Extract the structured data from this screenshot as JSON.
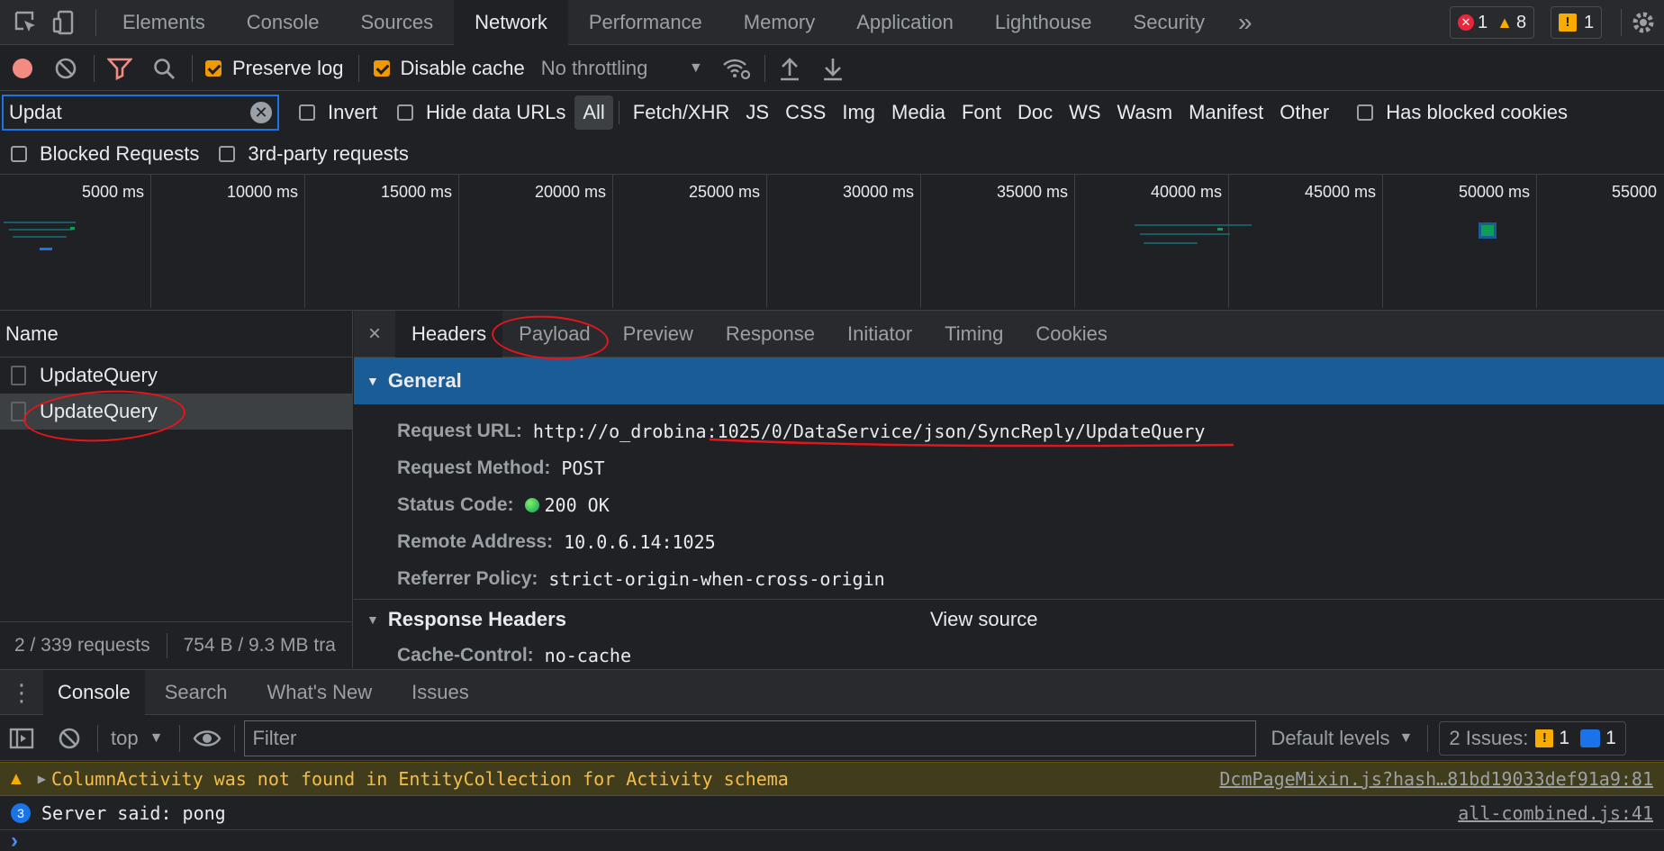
{
  "toolbar_top": {
    "tabs": [
      "Elements",
      "Console",
      "Sources",
      "Network",
      "Performance",
      "Memory",
      "Application",
      "Lighthouse",
      "Security"
    ],
    "more": "»",
    "errors_count": "1",
    "warnings_count": "8",
    "issues_count": "1"
  },
  "network_toolbar": {
    "preserve_log": "Preserve log",
    "disable_cache": "Disable cache",
    "throttling": "No throttling"
  },
  "filter_bar": {
    "search_value": "Updat",
    "invert": "Invert",
    "hide_data_urls": "Hide data URLs",
    "types": [
      "All",
      "Fetch/XHR",
      "JS",
      "CSS",
      "Img",
      "Media",
      "Font",
      "Doc",
      "WS",
      "Wasm",
      "Manifest",
      "Other"
    ],
    "has_blocked_cookies": "Has blocked cookies",
    "blocked_requests": "Blocked Requests",
    "third_party": "3rd-party requests"
  },
  "timeline": {
    "ticks": [
      "5000 ms",
      "10000 ms",
      "15000 ms",
      "20000 ms",
      "25000 ms",
      "30000 ms",
      "35000 ms",
      "40000 ms",
      "45000 ms",
      "50000 ms",
      "55000"
    ]
  },
  "request_list": {
    "header": "Name",
    "rows": [
      "UpdateQuery",
      "UpdateQuery"
    ],
    "status_requests": "2 / 339 requests",
    "status_transferred": "754 B / 9.3 MB tra"
  },
  "details": {
    "close": "×",
    "tabs": [
      "Headers",
      "Payload",
      "Preview",
      "Response",
      "Initiator",
      "Timing",
      "Cookies"
    ],
    "general_title": "General",
    "general": [
      {
        "key": "Request URL:",
        "value": "http://o_drobina:1025/0/DataService/json/SyncReply/UpdateQuery"
      },
      {
        "key": "Request Method:",
        "value": "POST"
      },
      {
        "key": "Status Code:",
        "value": "200 OK"
      },
      {
        "key": "Remote Address:",
        "value": "10.0.6.14:1025"
      },
      {
        "key": "Referrer Policy:",
        "value": "strict-origin-when-cross-origin"
      }
    ],
    "response_headers_title": "Response Headers",
    "view_source": "View source",
    "response_headers": [
      {
        "key": "Cache-Control:",
        "value": "no-cache"
      }
    ]
  },
  "drawer": {
    "tabs": [
      "Console",
      "Search",
      "What's New",
      "Issues"
    ],
    "context": "top",
    "filter_placeholder": "Filter",
    "levels": "Default levels",
    "issues_label": "2 Issues:",
    "issues_warn": "1",
    "issues_info": "1"
  },
  "console_messages": [
    {
      "type": "warning",
      "text": "ColumnActivity was not found in EntityCollection for Activity schema",
      "source": "DcmPageMixin.js?hash…81bd19033def91a9:81"
    },
    {
      "type": "info",
      "count": "3",
      "text": "Server said: pong",
      "source": "all-combined.js:41"
    }
  ],
  "prompt": "›",
  "colors": {
    "accent_blue": "#1a5c96",
    "warning_bg": "#413c1b",
    "warning_text": "#f4bd4a",
    "record_red": "#f28b82",
    "annotation_red": "#e8141c"
  }
}
